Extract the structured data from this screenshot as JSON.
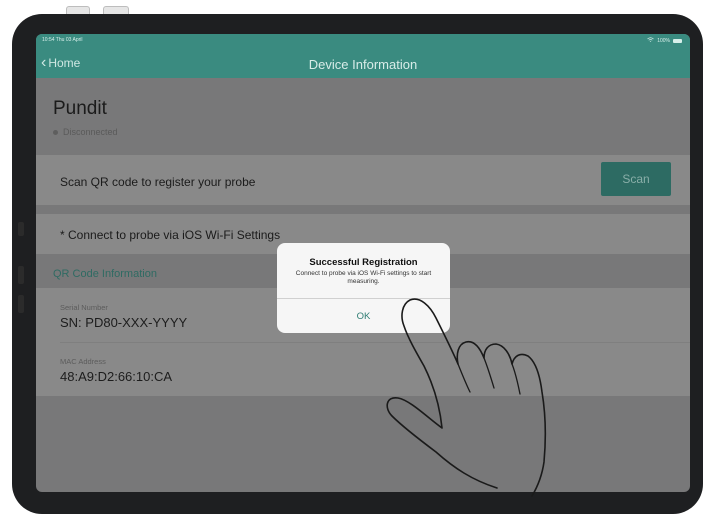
{
  "status_bar": {
    "time": "10:54 Thu 03 April",
    "battery": "100%"
  },
  "nav": {
    "back_label": "Home",
    "title": "Device Information"
  },
  "device": {
    "name": "Pundit",
    "connection_status": "Disconnected"
  },
  "scan_section": {
    "label": "Scan QR code to register your probe",
    "button_label": "Scan"
  },
  "connect_note": "* Connect to probe via iOS Wi-Fi Settings",
  "qr_info": {
    "header": "QR Code Information",
    "serial_label": "Serial Number",
    "serial_value": "SN: PD80-XXX-YYYY",
    "mac_label": "MAC Address",
    "mac_value": "48:A9:D2:66:10:CA"
  },
  "dialog": {
    "title": "Successful Registration",
    "message": "Connect to probe via iOS Wi-Fi settings to start measuring.",
    "ok_label": "OK"
  },
  "colors": {
    "accent": "#3a8b80",
    "button_dimmed": "#2d6b63"
  },
  "icons": [
    "chevron-left-icon",
    "wifi-icon",
    "battery-icon",
    "status-dot-icon",
    "pointing-hand-icon"
  ]
}
